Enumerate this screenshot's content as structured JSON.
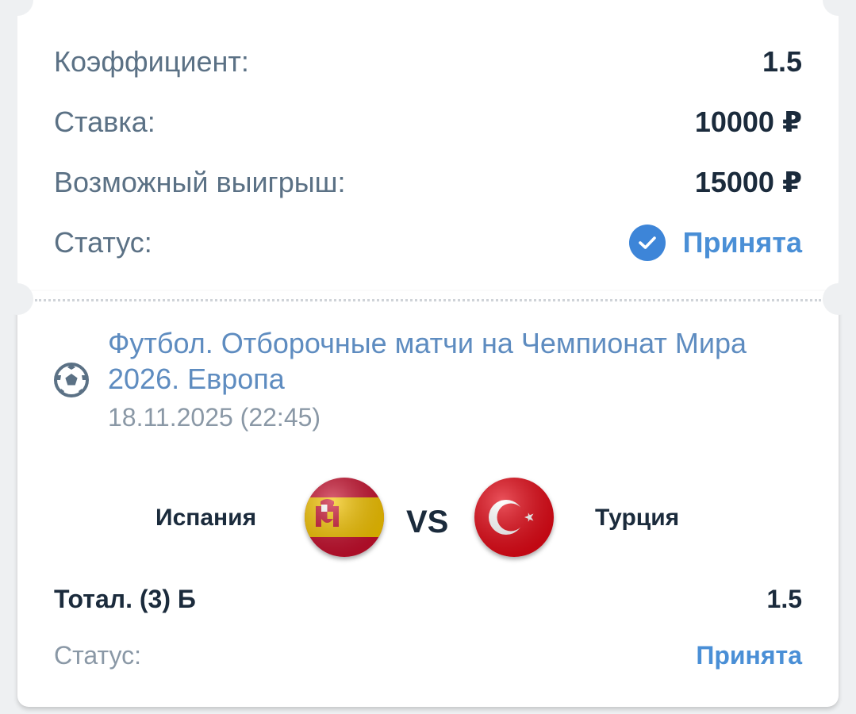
{
  "summary": {
    "coefficient_label": "Коэффициент:",
    "coefficient_value": "1.5",
    "stake_label": "Ставка:",
    "stake_value": "10000 ₽",
    "win_label": "Возможный выигрыш:",
    "win_value": "15000 ₽",
    "status_label": "Статус:",
    "status_value": "Принята"
  },
  "event": {
    "title": "Футбол. Отборочные матчи на Чемпионат Мира 2026. Европа",
    "date": "18.11.2025 (22:45)",
    "icon": "football-icon"
  },
  "match": {
    "home_team": "Испания",
    "away_team": "Турция",
    "vs_label": "VS"
  },
  "bet": {
    "market": "Тотал. (3) Б",
    "odds": "1.5",
    "status_label": "Статус:",
    "status_value": "Принята"
  },
  "colors": {
    "accent": "#3d85d8",
    "label": "#5b7185",
    "value": "#1b2b3c"
  }
}
